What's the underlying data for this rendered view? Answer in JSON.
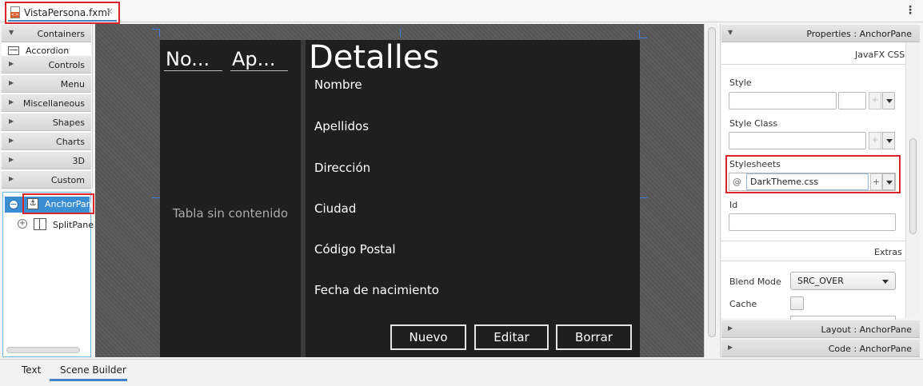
{
  "document_tab": {
    "title": "VistaPersona.fxml",
    "close": "×"
  },
  "menu": {
    "kebab": "⋮"
  },
  "library": {
    "sections": [
      {
        "label": "Containers",
        "expanded": true
      },
      {
        "label": "Controls",
        "expanded": false
      },
      {
        "label": "Menu",
        "expanded": false
      },
      {
        "label": "Miscellaneous",
        "expanded": false
      },
      {
        "label": "Shapes",
        "expanded": false
      },
      {
        "label": "Charts",
        "expanded": false
      },
      {
        "label": "3D",
        "expanded": false
      },
      {
        "label": "Custom",
        "expanded": false
      }
    ],
    "visible_item": "Accordion"
  },
  "hierarchy": {
    "root": {
      "label": "AnchorPane",
      "toggle": "−"
    },
    "child": {
      "label": "SplitPane",
      "toggle": "+"
    }
  },
  "preview": {
    "table_columns": [
      "No...",
      "Ap..."
    ],
    "table_placeholder": "Tabla sin contenido",
    "details_title": "Detalles",
    "fields": [
      "Nombre",
      "Apellidos",
      "Dirección",
      "Ciudad",
      "Código Postal",
      "Fecha de nacimiento"
    ],
    "buttons": [
      "Nuevo",
      "Editar",
      "Borrar"
    ]
  },
  "inspector": {
    "properties_header": "Properties : AnchorPane",
    "css_section": "JavaFX CSS",
    "style_label": "Style",
    "style_class_label": "Style Class",
    "stylesheets_label": "Stylesheets",
    "stylesheet_value": "DarkTheme.css",
    "stylesheet_at": "@",
    "plus": "+",
    "id_label": "Id",
    "extras_section": "Extras",
    "blend_mode_label": "Blend Mode",
    "blend_mode_value": "SRC_OVER",
    "cache_label": "Cache",
    "cache_checked": false,
    "layout_header": "Layout : AnchorPane",
    "code_header": "Code : AnchorPane"
  },
  "bottom_tabs": [
    "Text",
    "Scene Builder"
  ],
  "colors": {
    "highlight_red": "#d9262c",
    "accent_blue": "#3b8ed3",
    "dark_bg": "#1f1f1f"
  }
}
